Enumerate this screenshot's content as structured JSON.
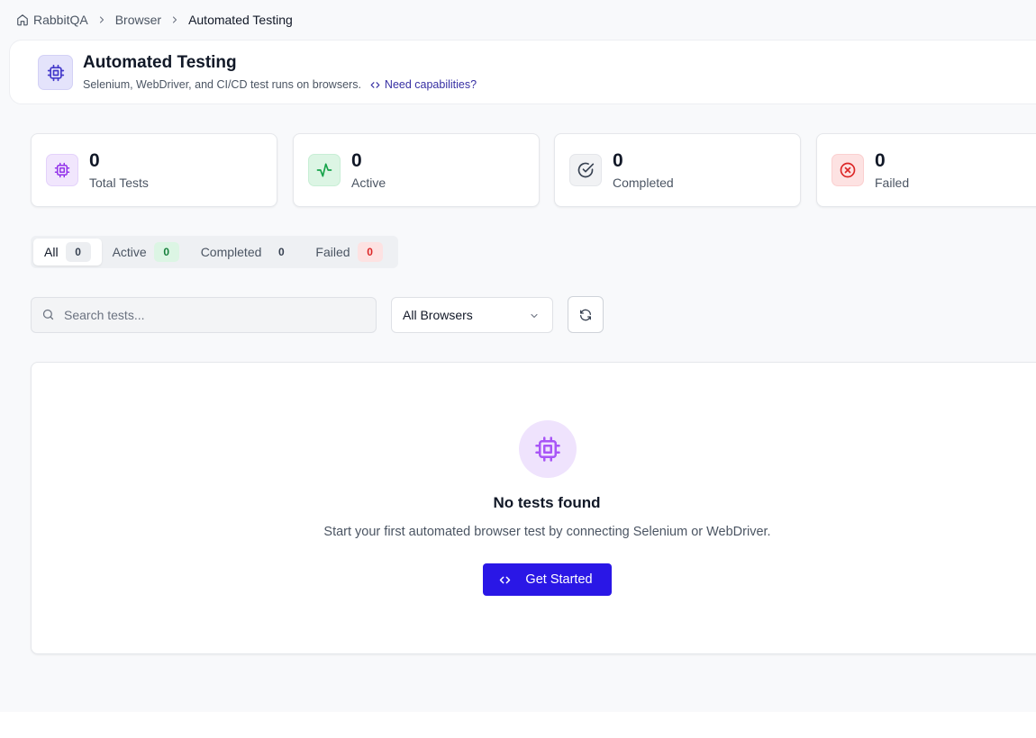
{
  "breadcrumb": {
    "home": "RabbitQA",
    "section": "Browser",
    "current": "Automated Testing"
  },
  "header": {
    "title": "Automated Testing",
    "subtitle": "Selenium, WebDriver, and CI/CD test runs on browsers.",
    "link": "Need capabilities?"
  },
  "stats": [
    {
      "value": "0",
      "label": "Total Tests",
      "icon": "cpu-icon",
      "color": "#9333ea"
    },
    {
      "value": "0",
      "label": "Active",
      "icon": "activity-icon",
      "color": "#16a34a"
    },
    {
      "value": "0",
      "label": "Completed",
      "icon": "check-circle-icon",
      "color": "#374151"
    },
    {
      "value": "0",
      "label": "Failed",
      "icon": "x-circle-icon",
      "color": "#dc2626"
    }
  ],
  "tabs": [
    {
      "label": "All",
      "count": "0"
    },
    {
      "label": "Active",
      "count": "0"
    },
    {
      "label": "Completed",
      "count": "0"
    },
    {
      "label": "Failed",
      "count": "0"
    }
  ],
  "filters": {
    "search_placeholder": "Search tests...",
    "browser_select": "All Browsers"
  },
  "empty": {
    "title": "No tests found",
    "description": "Start your first automated browser test by connecting Selenium or WebDriver.",
    "cta": "Get Started"
  },
  "colors": {
    "accent": "#2a17e6",
    "link": "#3730a3"
  }
}
